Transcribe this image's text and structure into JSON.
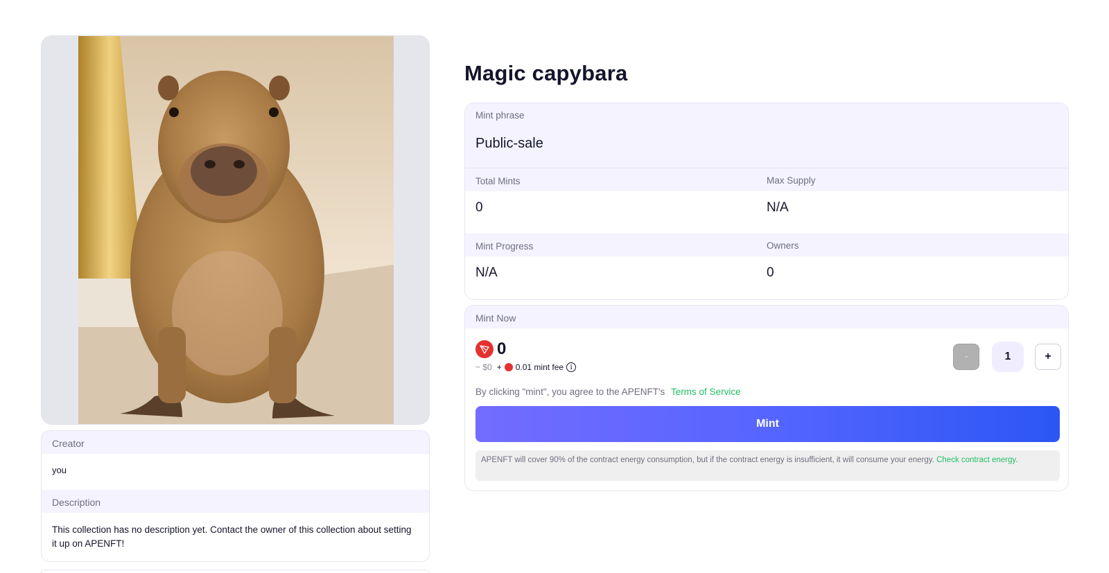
{
  "nft": {
    "title": "Magic capybara",
    "image_alt": "capybara photo"
  },
  "info": {
    "creator_label": "Creator",
    "creator_value": "you",
    "description_label": "Description",
    "description_text": "This collection has no description yet. Contact the owner of this collection about setting it up on APENFT!"
  },
  "stats": {
    "phase_label": "Mint phrase",
    "phase_value": "Public-sale",
    "total_mints_label": "Total Mints",
    "total_mints_value": "0",
    "max_supply_label": "Max Supply",
    "max_supply_value": "N/A",
    "progress_label": "Mint Progress",
    "progress_value": "N/A",
    "owners_label": "Owners",
    "owners_value": "0"
  },
  "mint": {
    "header": "Mint Now",
    "price": "0",
    "usd": "~ $0",
    "fee_plus": "+",
    "fee_amount": "0.01",
    "fee_label": "mint fee",
    "info_icon": "i",
    "quantity": "1",
    "minus": "-",
    "plus": "+",
    "terms_text": "By clicking \"mint\", you agree to the APENFT's",
    "terms_link": "Terms of Service",
    "button": "Mint",
    "energy_text": "APENFT will cover 90% of the contract energy consumption, but if the contract energy is insufficient, it will consume your energy.",
    "energy_link": "Check contract energy."
  },
  "icons": {
    "token": "tron-icon",
    "info": "info-icon"
  },
  "colors": {
    "accent_start": "#736cff",
    "accent_end": "#2b56f4",
    "link_green": "#21c065",
    "token_red": "#e5312f",
    "panel_tint": "#f4f3ff"
  }
}
